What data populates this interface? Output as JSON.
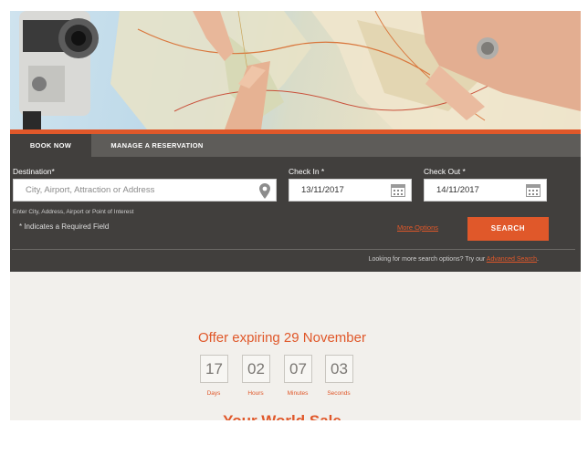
{
  "tabs": {
    "book_now": "BOOK NOW",
    "manage": "MANAGE A RESERVATION"
  },
  "destination": {
    "label": "Destination*",
    "placeholder": "City, Airport, Attraction or Address",
    "hint": "Enter City, Address, Airport or Point of Interest",
    "icon": "location-pin-icon"
  },
  "check_in": {
    "label": "Check In *",
    "value": "13/11/2017",
    "icon": "calendar-icon"
  },
  "check_out": {
    "label": "Check Out *",
    "value": "14/11/2017",
    "icon": "calendar-icon"
  },
  "required_note": "* Indicates a Required Field",
  "more_options": "More Options",
  "search_button": "SEARCH",
  "footer": {
    "text": "Looking for more search options? Try our",
    "link": "Advanced Search",
    "end": "."
  },
  "offer": {
    "title": "Offer expiring 29 November",
    "countdown": [
      {
        "value": "17",
        "label": "Days"
      },
      {
        "value": "02",
        "label": "Hours"
      },
      {
        "value": "07",
        "label": "Minutes"
      },
      {
        "value": "03",
        "label": "Seconds"
      }
    ],
    "sale_title": "Your World Sale"
  },
  "colors": {
    "accent": "#e0582a",
    "panel": "#413f3d",
    "tabbar": "#5e5c59",
    "offer_bg": "#f2f0ec"
  }
}
